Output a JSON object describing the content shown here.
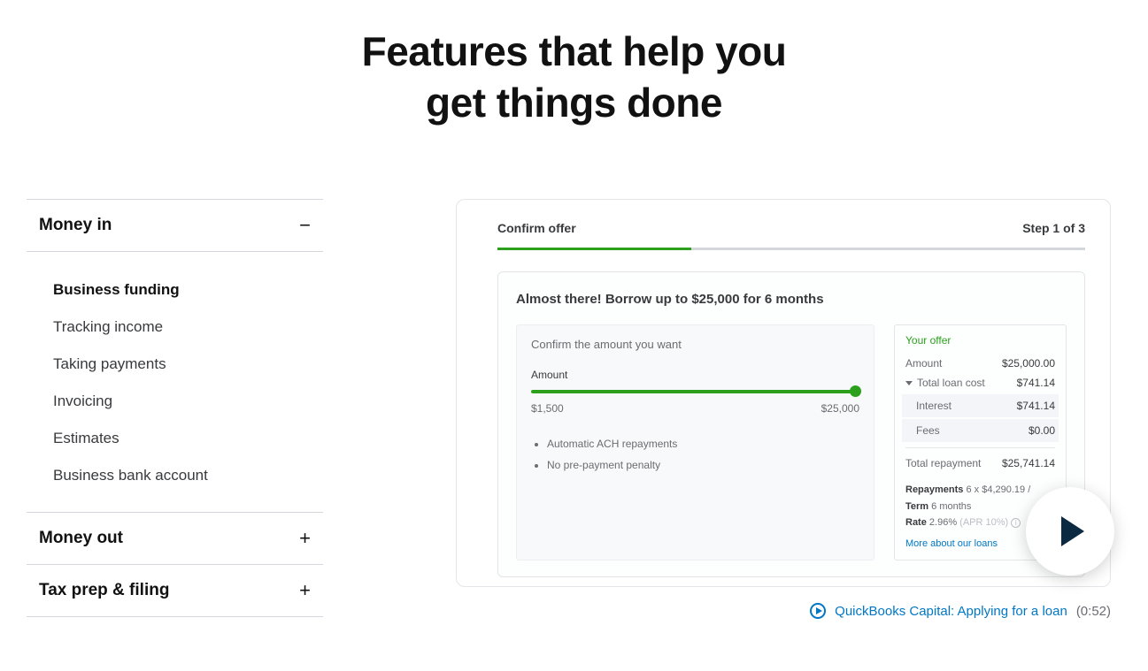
{
  "page": {
    "title_line1": "Features that help you",
    "title_line2": "get things done"
  },
  "sidebar": {
    "sections": [
      {
        "label": "Money in",
        "expanded": true,
        "icon": "−",
        "items": [
          {
            "label": "Business funding",
            "active": true
          },
          {
            "label": "Tracking income",
            "active": false
          },
          {
            "label": "Taking payments",
            "active": false
          },
          {
            "label": "Invoicing",
            "active": false
          },
          {
            "label": "Estimates",
            "active": false
          },
          {
            "label": "Business bank account",
            "active": false
          }
        ]
      },
      {
        "label": "Money out",
        "expanded": false,
        "icon": "+"
      },
      {
        "label": "Tax prep & filing",
        "expanded": false,
        "icon": "+"
      }
    ]
  },
  "card": {
    "header_title": "Confirm offer",
    "step_label": "Step 1 of 3",
    "heading": "Almost there! Borrow up to $25,000 for 6 months",
    "confirm_label": "Confirm the amount you want",
    "amount_label": "Amount",
    "range_min": "$1,500",
    "range_max": "$25,000",
    "bullets": [
      "Automatic ACH repayments",
      "No pre-payment penalty"
    ],
    "offer": {
      "title": "Your offer",
      "rows": {
        "amount_label": "Amount",
        "amount_value": "$25,000.00",
        "total_cost_label": "Total loan cost",
        "total_cost_value": "$741.14",
        "interest_label": "Interest",
        "interest_value": "$741.14",
        "fees_label": "Fees",
        "fees_value": "$0.00",
        "total_repay_label": "Total repayment",
        "total_repay_value": "$25,741.14"
      },
      "meta": {
        "repayments_label": "Repayments",
        "repayments_value": "6 x $4,290.19 /",
        "term_label": "Term",
        "term_value": "6 months",
        "rate_label": "Rate",
        "rate_value": "2.96%",
        "rate_extra": "(APR 10%)"
      },
      "link": "More about our loans"
    }
  },
  "video_meta": {
    "title": "QuickBooks Capital: Applying for a loan",
    "duration": "(0:52)"
  }
}
